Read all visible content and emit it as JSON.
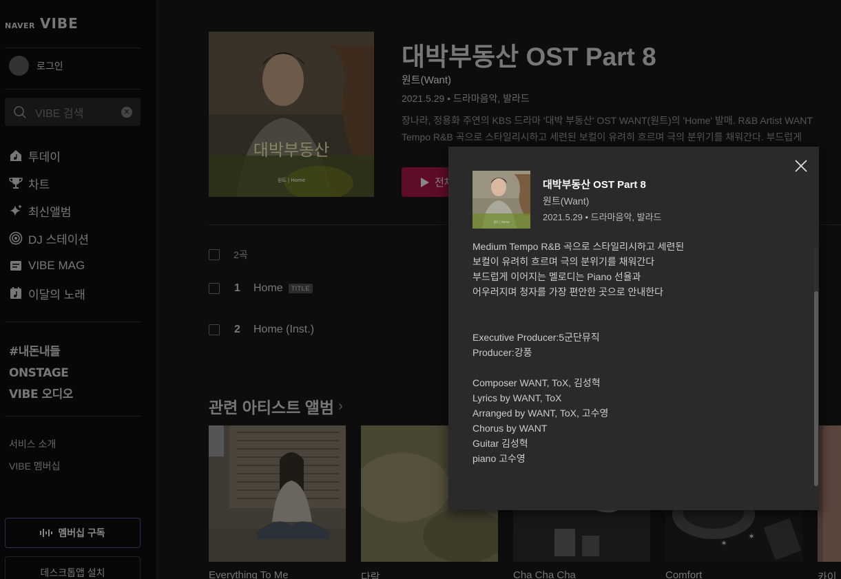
{
  "sidebar": {
    "logo_naver": "NAVER",
    "logo_vibe": "VIBE",
    "login_label": "로그인",
    "search_placeholder": "VIBE 검색",
    "nav": [
      {
        "label": "투데이",
        "icon": "home-music-icon"
      },
      {
        "label": "차트",
        "icon": "trophy-icon"
      },
      {
        "label": "최신앨범",
        "icon": "sparkle-icon"
      },
      {
        "label": "DJ 스테이션",
        "icon": "radio-icon"
      },
      {
        "label": "VIBE MAG",
        "icon": "magazine-icon"
      },
      {
        "label": "이달의 노래",
        "icon": "calendar-music-icon"
      }
    ],
    "special": [
      "#내돈내들",
      "ONSTAGE",
      "VIBE 오디오"
    ],
    "links": [
      "서비스 소개",
      "VIBE 멤버십"
    ],
    "membership_button": "멤버십 구독",
    "desktop_button": "데스크톱앱 설치"
  },
  "album": {
    "title": "대박부동산 OST Part 8",
    "artist": "원트(Want)",
    "meta": "2021.5.29 • 드라마음악, 발라드",
    "description_lines": [
      "장나라, 정용화 주연의 KBS 드라마 '대박 부동산' OST WANT(원트)의 'Home' 발매. R&B Artist WANT",
      "Tempo R&B 곡으로 스타일리시하고 세련된 보컬이 유려히 흐르며 극의 분위기를 채워간다. 부드럽게"
    ],
    "play_label": "전체"
  },
  "tracks": {
    "count_label": "2곡",
    "items": [
      {
        "num": "1",
        "name": "Home",
        "badge": "TITLE"
      },
      {
        "num": "2",
        "name": "Home (Inst.)",
        "badge": ""
      }
    ]
  },
  "related": {
    "title": "관련 아티스트 앨범",
    "albums": [
      {
        "name": "Everything To Me"
      },
      {
        "name": "다람"
      },
      {
        "name": "Cha Cha Cha"
      },
      {
        "name": "Comfort"
      },
      {
        "name": "카이"
      }
    ]
  },
  "modal": {
    "title": "대박부동산 OST Part 8",
    "artist": "원트(Want)",
    "meta": "2021.5.29 • 드라마음악, 발라드",
    "lines": [
      "Medium Tempo R&B 곡으로 스타일리시하고 세련된",
      "보컬이 유려히 흐르며 극의 분위기를 채워간다",
      "부드럽게 이어지는 멜로디는 Piano 선율과",
      "어우러지며 청자를 가장 편안한 곳으로 안내한다",
      "",
      "",
      "Executive Producer:5군단뮤직",
      "Producer:강풍",
      "",
      "Composer WANT, ToX, 김성혁",
      "Lyrics by WANT, ToX",
      "Arranged by WANT, ToX, 고수영",
      "Chorus by WANT",
      "Guitar 김성혁",
      "piano 고수영"
    ]
  },
  "colors": {
    "accent": "#ff1150",
    "background": "#0d0d0d",
    "modal_bg": "#2a2a2a"
  }
}
